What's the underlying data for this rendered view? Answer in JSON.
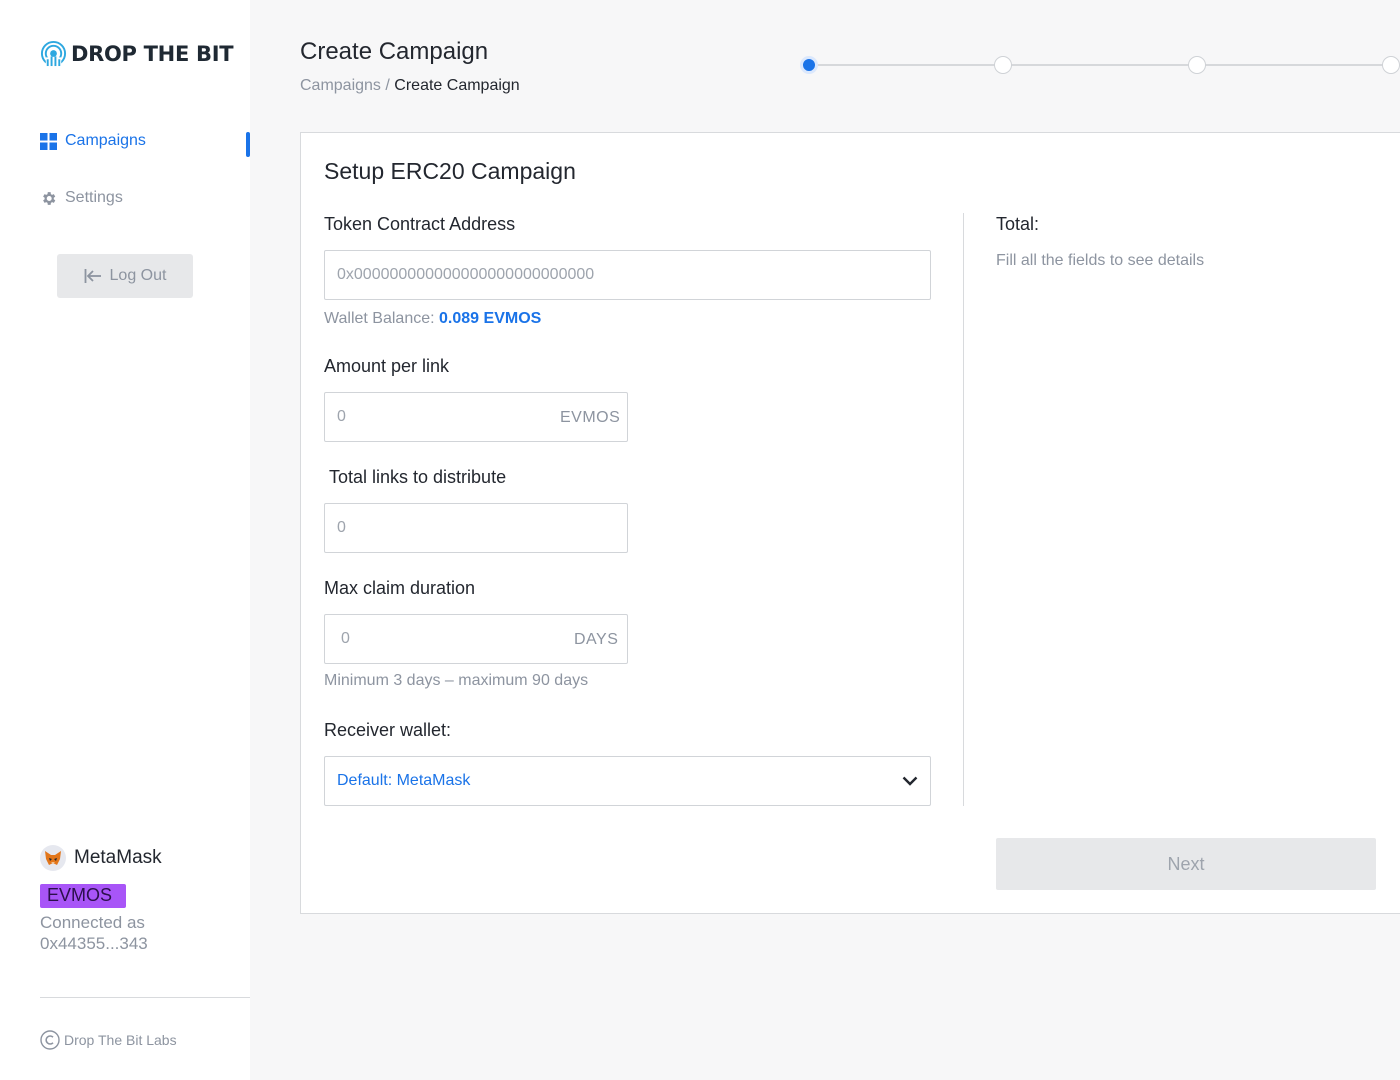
{
  "brand": {
    "name": "DROP THE BIT",
    "icon": "signal-broadcast-icon",
    "accent_color": "#1a73e8"
  },
  "sidebar": {
    "items": [
      {
        "label": "Campaigns",
        "icon": "grid-icon",
        "active": true
      },
      {
        "label": "Settings",
        "icon": "gear-icon",
        "active": false
      }
    ],
    "logout_label": "Log Out",
    "wallet": {
      "name": "MetaMask",
      "icon": "metamask-fox-icon",
      "network": "EVMOS",
      "network_color": "#a855f7",
      "connected_label": "Connected as",
      "address": "0x44355...343"
    },
    "footer": "Drop The Bit Labs"
  },
  "header": {
    "title": "Create Campaign",
    "breadcrumb": {
      "parent": "Campaigns",
      "separator": "/",
      "current": "Create Campaign"
    },
    "stepper": {
      "total_steps": 4,
      "current_step": 1
    }
  },
  "form": {
    "title": "Setup ERC20 Campaign",
    "token_address": {
      "label": "Token Contract Address",
      "placeholder": "0x000000000000000000000000000"
    },
    "wallet_balance": {
      "label": "Wallet Balance:",
      "value": "0.089 EVMOS"
    },
    "amount_per_link": {
      "label": "Amount per link",
      "placeholder": "0",
      "suffix": "EVMOS"
    },
    "total_links": {
      "label": "Total links to distribute",
      "placeholder": "0"
    },
    "max_claim_duration": {
      "label": "Max claim duration",
      "placeholder": "0",
      "suffix": "DAYS",
      "hint": "Minimum 3 days – maximum 90 days"
    },
    "receiver_wallet": {
      "label": "Receiver wallet:",
      "selected": "Default: MetaMask"
    }
  },
  "summary": {
    "label": "Total:",
    "hint": "Fill all the fields to see details"
  },
  "actions": {
    "next_label": "Next"
  }
}
